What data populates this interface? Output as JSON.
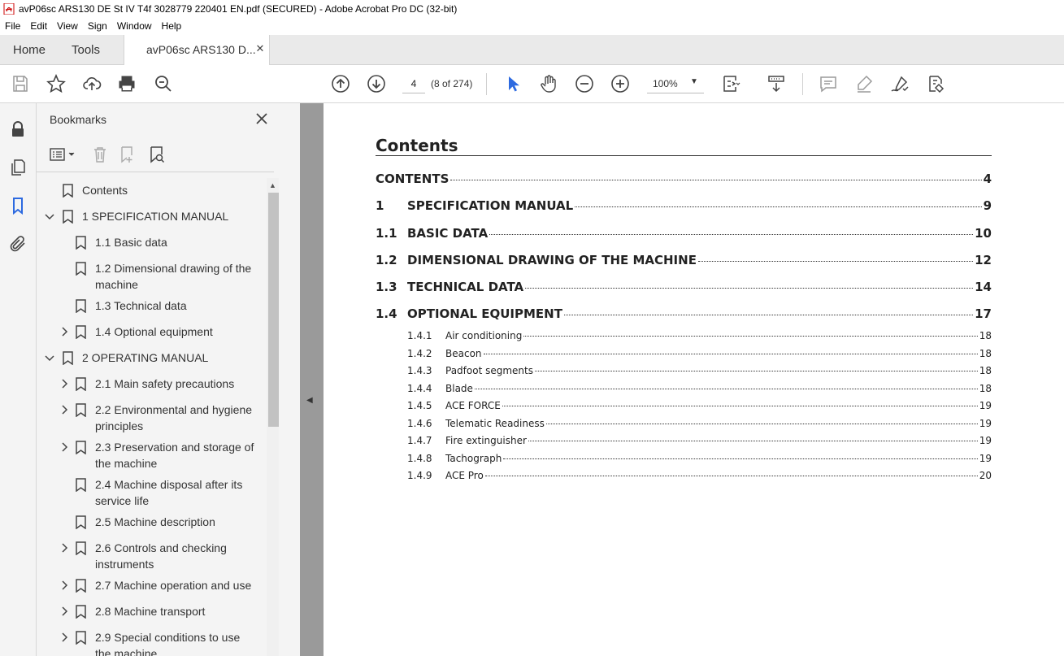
{
  "window": {
    "title": "avP06sc ARS130 DE St IV T4f 3028779 220401 EN.pdf (SECURED) - Adobe Acrobat Pro DC (32-bit)"
  },
  "menu": [
    "File",
    "Edit",
    "View",
    "Sign",
    "Window",
    "Help"
  ],
  "tabs": {
    "home": "Home",
    "tools": "Tools",
    "document": "avP06sc ARS130 D..."
  },
  "toolbar": {
    "page_number": "4",
    "page_count": "(8 of 274)",
    "zoom": "100%"
  },
  "bookmarks": {
    "title": "Bookmarks",
    "items": [
      {
        "label": "Contents"
      },
      {
        "label": "1 SPECIFICATION MANUAL"
      },
      {
        "label": "1.1 Basic data"
      },
      {
        "label": "1.2 Dimensional drawing of the",
        "label2": "machine"
      },
      {
        "label": "1.3 Technical data"
      },
      {
        "label": "1.4 Optional equipment"
      },
      {
        "label": "2 OPERATING MANUAL"
      },
      {
        "label": "2.1 Main safety precautions"
      },
      {
        "label": "2.2 Environmental and hygiene",
        "label2": "principles"
      },
      {
        "label": "2.3 Preservation and storage of",
        "label2": "the machine"
      },
      {
        "label": "2.4 Machine disposal after its",
        "label2": "service life"
      },
      {
        "label": "2.5 Machine description"
      },
      {
        "label": "2.6 Controls and checking",
        "label2": "instruments"
      },
      {
        "label": "2.7 Machine operation and use"
      },
      {
        "label": "2.8 Machine transport"
      },
      {
        "label": "2.9 Special conditions to use",
        "label2": "the machine"
      }
    ]
  },
  "document": {
    "heading": "Contents",
    "toc": [
      {
        "num": "",
        "label": "CONTENTS",
        "page": "4"
      },
      {
        "num": "1",
        "label": "SPECIFICATION MANUAL",
        "page": "9"
      },
      {
        "num": "1.1",
        "label": "BASIC DATA",
        "page": "10"
      },
      {
        "num": "1.2",
        "label": "DIMENSIONAL DRAWING OF THE MACHINE",
        "page": "12"
      },
      {
        "num": "1.3",
        "label": "TECHNICAL DATA",
        "page": "14"
      },
      {
        "num": "1.4",
        "label": "OPTIONAL EQUIPMENT",
        "page": "17"
      }
    ],
    "subtoc": [
      {
        "num": "1.4.1",
        "label": "Air conditioning",
        "page": "18"
      },
      {
        "num": "1.4.2",
        "label": "Beacon",
        "page": "18"
      },
      {
        "num": "1.4.3",
        "label": "Padfoot segments",
        "page": "18"
      },
      {
        "num": "1.4.4",
        "label": "Blade",
        "page": "18"
      },
      {
        "num": "1.4.5",
        "label": "ACE FORCE",
        "page": "19"
      },
      {
        "num": "1.4.6",
        "label": "Telematic Readiness",
        "page": "19"
      },
      {
        "num": "1.4.7",
        "label": "Fire extinguisher",
        "page": "19"
      },
      {
        "num": "1.4.8",
        "label": "Tachograph",
        "page": "19"
      },
      {
        "num": "1.4.9",
        "label": "ACE Pro",
        "page": "20"
      }
    ]
  }
}
